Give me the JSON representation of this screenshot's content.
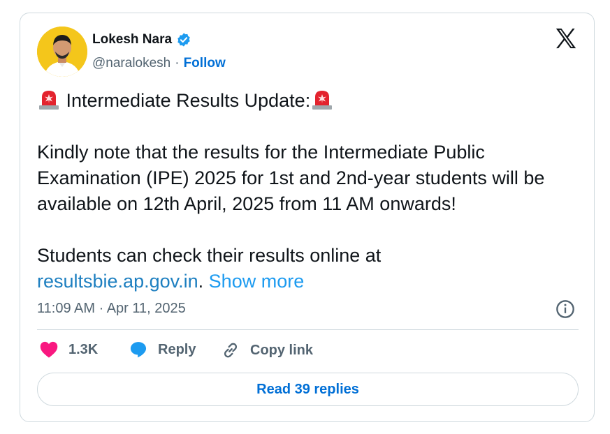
{
  "author": {
    "name": "Lokesh Nara",
    "handle": "@naralokesh",
    "separator": "·",
    "follow_label": "Follow",
    "verified_color": "#1d9bf0"
  },
  "tweet": {
    "headline": "Intermediate Results Update:",
    "paragraph1": "Kindly note that the results for the Intermediate Public Examination (IPE) 2025 for 1st and 2nd-year students will be available on 12th April, 2025 from 11 AM onwards!",
    "paragraph2_prefix": "Students can check their results online at",
    "link_text": "resultsbie.ap.gov.in",
    "link_suffix": ".",
    "show_more": "Show more",
    "timestamp": "11:09 AM · Apr 11, 2025"
  },
  "actions": {
    "like_count": "1.3K",
    "reply_label": "Reply",
    "copy_label": "Copy link"
  },
  "read_replies_label": "Read 39 replies",
  "icons": [
    "verified-badge-icon",
    "x-logo-icon",
    "siren-icon",
    "info-icon",
    "heart-icon",
    "reply-bubble-icon",
    "link-icon"
  ],
  "colors": {
    "accent": "#006fd6",
    "link": "#1d7fc0",
    "like": "#f91880",
    "reply": "#1d9bf0",
    "muted": "#536471"
  }
}
